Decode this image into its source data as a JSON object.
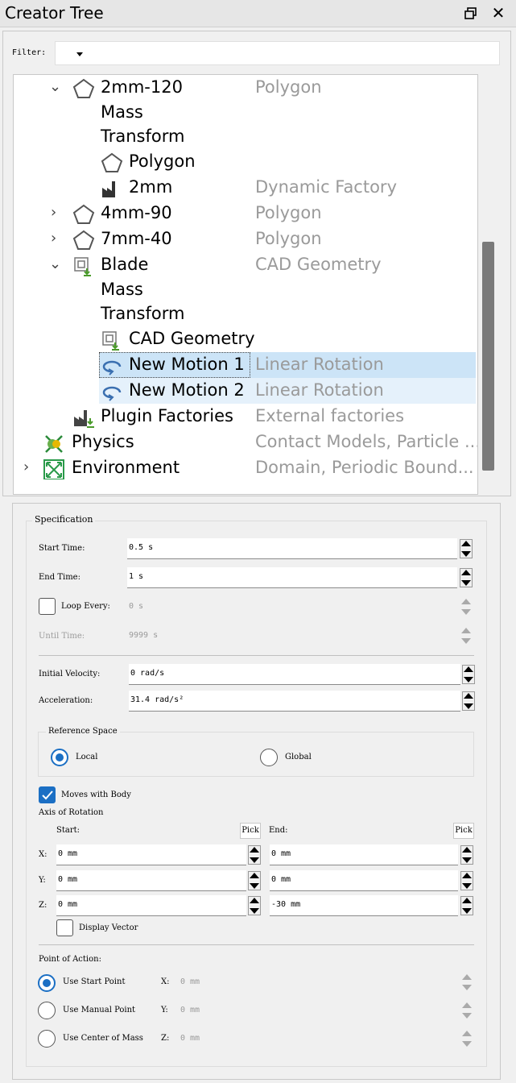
{
  "window": {
    "title": "Creator Tree"
  },
  "filter": {
    "label": "Filter:",
    "value": ""
  },
  "tree": [
    {
      "label": "2mm-120",
      "type": "Polygon",
      "icon": "polygon-icon",
      "expander": "down"
    },
    {
      "label": "Mass",
      "type": ""
    },
    {
      "label": "Transform",
      "type": ""
    },
    {
      "label": "Polygon",
      "type": "",
      "icon": "polygon-icon"
    },
    {
      "label": "2mm",
      "type": "Dynamic Factory",
      "icon": "factory-icon"
    },
    {
      "label": "4mm-90",
      "type": "Polygon",
      "icon": "polygon-icon",
      "expander": "right"
    },
    {
      "label": "7mm-40",
      "type": "Polygon",
      "icon": "polygon-icon",
      "expander": "right"
    },
    {
      "label": "Blade",
      "type": "CAD Geometry",
      "icon": "cad-geometry-icon",
      "expander": "down"
    },
    {
      "label": "Mass",
      "type": ""
    },
    {
      "label": "Transform",
      "type": ""
    },
    {
      "label": "CAD Geometry",
      "type": "",
      "icon": "cad-geometry-icon"
    },
    {
      "label": "New Motion 1",
      "type": "Linear Rotation",
      "icon": "rotation-icon",
      "selected": true
    },
    {
      "label": "New Motion 2",
      "type": "Linear Rotation",
      "icon": "rotation-icon"
    },
    {
      "label": "Plugin Factories",
      "type": "External factories",
      "icon": "factory-icon"
    },
    {
      "label": "Physics",
      "type": "Contact Models, Particle ...",
      "icon": "physics-icon"
    },
    {
      "label": "Environment",
      "type": "Domain, Periodic Bound...",
      "icon": "environment-icon",
      "expander": "right"
    }
  ],
  "spec": {
    "title": "Specification",
    "start_time": {
      "label": "Start Time:",
      "value": "0.5 s"
    },
    "end_time": {
      "label": "End Time:",
      "value": "1 s"
    },
    "loop_every": {
      "label": "Loop Every:",
      "value": "0 s",
      "checked": false
    },
    "until_time": {
      "label": "Until Time:",
      "value": "9999 s"
    },
    "initial_velocity": {
      "label": "Initial Velocity:",
      "value": "0 rad/s"
    },
    "acceleration": {
      "label": "Acceleration:",
      "value": "31.4 rad/s²"
    },
    "reference_space": {
      "title": "Reference Space",
      "local": "Local",
      "global": "Global",
      "selected": "Local"
    },
    "moves_with_body": {
      "label": "Moves with Body",
      "checked": true
    },
    "axis": {
      "title": "Axis of Rotation",
      "start_label": "Start:",
      "end_label": "End:",
      "pick": "Pick",
      "x_label": "X:",
      "y_label": "Y:",
      "z_label": "Z:",
      "start": {
        "x": "0 mm",
        "y": "0 mm",
        "z": "0 mm"
      },
      "end": {
        "x": "0 mm",
        "y": "0 mm",
        "z": "-30 mm"
      }
    },
    "display_vector": {
      "label": "Display Vector",
      "checked": false
    },
    "point_of_action": {
      "title": "Point of Action:",
      "use_start": "Use Start Point",
      "use_manual": "Use Manual Point",
      "use_center": "Use Center of Mass",
      "selected": "Use Start Point",
      "x_label": "X:",
      "y_label": "Y:",
      "z_label": "Z:",
      "x": "0 mm",
      "y": "0 mm",
      "z": "0 mm"
    }
  },
  "colors": {
    "selection": "#cce4f7",
    "hover": "#e5f1fb",
    "accent": "#1b6fc4",
    "type_text": "#9a9a9a"
  }
}
